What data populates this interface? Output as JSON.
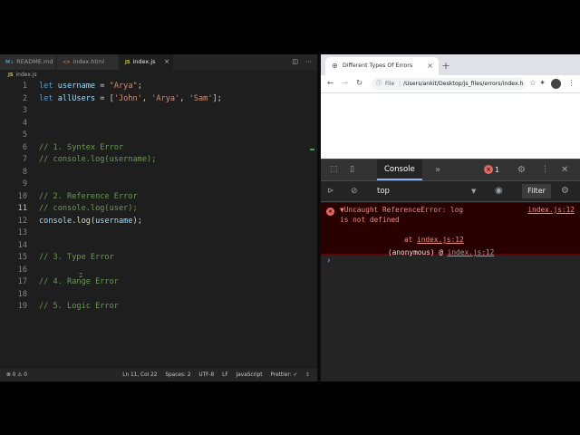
{
  "editor": {
    "tabs": [
      {
        "icon": "M↓",
        "label": "README.md",
        "type": "md"
      },
      {
        "icon": "<>",
        "label": "index.html",
        "type": "html"
      },
      {
        "icon": "JS",
        "label": "index.js",
        "type": "js",
        "close": "×"
      }
    ],
    "breadcrumb": {
      "icon": "JS",
      "label": "index.js"
    },
    "lines": [
      {
        "n": "1",
        "parts": [
          {
            "c": "kw",
            "t": "let "
          },
          {
            "c": "var",
            "t": "username"
          },
          {
            "c": "",
            "t": " = "
          },
          {
            "c": "str",
            "t": "\"Arya\""
          },
          {
            "c": "",
            "t": ";"
          }
        ]
      },
      {
        "n": "2",
        "parts": [
          {
            "c": "kw",
            "t": "let "
          },
          {
            "c": "var",
            "t": "allUsers"
          },
          {
            "c": "",
            "t": " = ["
          },
          {
            "c": "str",
            "t": "'John'"
          },
          {
            "c": "",
            "t": ", "
          },
          {
            "c": "str",
            "t": "'Arya'"
          },
          {
            "c": "",
            "t": ", "
          },
          {
            "c": "str",
            "t": "'Sam'"
          },
          {
            "c": "",
            "t": "];"
          }
        ]
      },
      {
        "n": "3",
        "parts": []
      },
      {
        "n": "4",
        "parts": []
      },
      {
        "n": "5",
        "parts": []
      },
      {
        "n": "6",
        "parts": [
          {
            "c": "cmt",
            "t": "// 1. Syntex Error"
          }
        ]
      },
      {
        "n": "7",
        "parts": [
          {
            "c": "cmt",
            "t": "// console.log(username);"
          }
        ]
      },
      {
        "n": "8",
        "parts": []
      },
      {
        "n": "9",
        "parts": []
      },
      {
        "n": "10",
        "parts": [
          {
            "c": "cmt",
            "t": "// 2. Reference Error"
          }
        ]
      },
      {
        "n": "11",
        "parts": [
          {
            "c": "cmt",
            "t": "// console.log(user);"
          }
        ],
        "current": true
      },
      {
        "n": "12",
        "parts": [
          {
            "c": "var",
            "t": "console"
          },
          {
            "c": "",
            "t": "."
          },
          {
            "c": "fn",
            "t": "log"
          },
          {
            "c": "",
            "t": "("
          },
          {
            "c": "var",
            "t": "username"
          },
          {
            "c": "",
            "t": ");"
          }
        ]
      },
      {
        "n": "13",
        "parts": []
      },
      {
        "n": "14",
        "parts": []
      },
      {
        "n": "15",
        "parts": [
          {
            "c": "cmt",
            "t": "// 3. Type Error"
          }
        ]
      },
      {
        "n": "16",
        "parts": []
      },
      {
        "n": "17",
        "parts": [
          {
            "c": "cmt",
            "t": "// 4. Range Error"
          }
        ]
      },
      {
        "n": "18",
        "parts": []
      },
      {
        "n": "19",
        "parts": [
          {
            "c": "cmt",
            "t": "// 5. Logic Error"
          }
        ]
      }
    ],
    "status": {
      "problems": "⊗ 0 ⚠ 0",
      "position": "Ln 11, Col 22",
      "spaces": "Spaces: 2",
      "encoding": "UTF-8",
      "eol": "LF",
      "language": "JavaScript",
      "prettier": "Prettier: ✓"
    }
  },
  "browser": {
    "tab_title": "Different Types Of Errors",
    "new_tab": "+",
    "tab_close": "×",
    "url_prefix": "File",
    "url": "/Users/ankit/Desktop/js_files/errors/index.html",
    "devtools": {
      "active_tab": "Console",
      "error_count": "1",
      "context": "top",
      "filter_label": "Filter",
      "error": {
        "line1": "▼Uncaught ReferenceError: log",
        "source": "index.js:12",
        "line2": "is not defined",
        "at_prefix": "at ",
        "at_link": "index.js:12",
        "anon_prefix": "(anonymous) @ ",
        "anon_link": "index.js:12"
      },
      "prompt": "›"
    }
  },
  "colors": {
    "editor_bg": "#1e1e1e",
    "keyword": "#569cd6",
    "string": "#ce9178",
    "comment": "#6a9955",
    "error_text": "#f28b82",
    "error_bg": "#290000"
  }
}
